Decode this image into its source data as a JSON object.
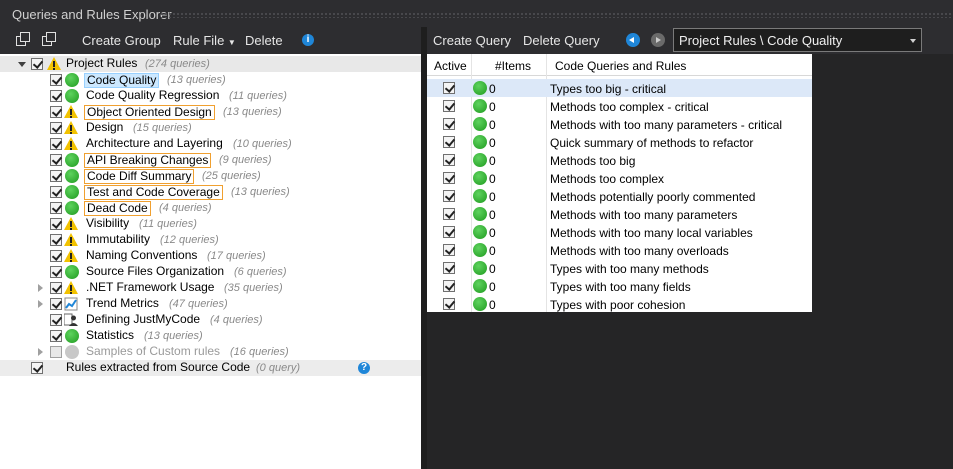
{
  "window": {
    "title": "Queries and Rules Explorer"
  },
  "left_toolbar": {
    "create_group": "Create Group",
    "rule_file": "Rule File",
    "delete": "Delete",
    "icons": [
      "collapse-all-icon",
      "expand-all-icon",
      "dropdown-arrow-icon",
      "info-icon"
    ]
  },
  "right_toolbar": {
    "create_query": "Create Query",
    "delete_query": "Delete Query",
    "breadcrumb_value": "Project Rules \\ Code Quality"
  },
  "tree": {
    "root": {
      "label": "Project Rules",
      "count": "(274 queries)",
      "checked": true,
      "status": "warning"
    },
    "groups": [
      {
        "label": "Code Quality",
        "count": "(13 queries)",
        "status": "ok",
        "checked": true,
        "expandable": false,
        "style": "selected"
      },
      {
        "label": "Code Quality Regression",
        "count": "(11 queries)",
        "status": "ok",
        "checked": true,
        "expandable": false,
        "style": ""
      },
      {
        "label": "Object Oriented Design",
        "count": "(13 queries)",
        "status": "warning",
        "checked": true,
        "expandable": false,
        "style": "boxed"
      },
      {
        "label": "Design",
        "count": "(15 queries)",
        "status": "warning",
        "checked": true,
        "expandable": false,
        "style": ""
      },
      {
        "label": "Architecture and Layering",
        "count": "(10 queries)",
        "status": "warning",
        "checked": true,
        "expandable": false,
        "style": ""
      },
      {
        "label": "API Breaking Changes",
        "count": "(9 queries)",
        "status": "ok",
        "checked": true,
        "expandable": false,
        "style": "boxed"
      },
      {
        "label": "Code Diff Summary",
        "count": "(25 queries)",
        "status": "ok",
        "checked": true,
        "expandable": false,
        "style": "boxed"
      },
      {
        "label": "Test and Code Coverage",
        "count": "(13 queries)",
        "status": "ok",
        "checked": true,
        "expandable": false,
        "style": "boxed"
      },
      {
        "label": "Dead Code",
        "count": "(4 queries)",
        "status": "ok",
        "checked": true,
        "expandable": false,
        "style": "boxed"
      },
      {
        "label": "Visibility",
        "count": "(11 queries)",
        "status": "warning",
        "checked": true,
        "expandable": false,
        "style": ""
      },
      {
        "label": "Immutability",
        "count": "(12 queries)",
        "status": "warning",
        "checked": true,
        "expandable": false,
        "style": ""
      },
      {
        "label": "Naming Conventions",
        "count": "(17 queries)",
        "status": "warning",
        "checked": true,
        "expandable": false,
        "style": ""
      },
      {
        "label": "Source Files Organization",
        "count": "(6 queries)",
        "status": "ok",
        "checked": true,
        "expandable": false,
        "style": ""
      },
      {
        "label": ".NET Framework Usage",
        "count": "(35 queries)",
        "status": "warning",
        "checked": true,
        "expandable": true,
        "style": ""
      },
      {
        "label": "Trend Metrics",
        "count": "(47 queries)",
        "status": "trend",
        "checked": true,
        "expandable": true,
        "style": ""
      },
      {
        "label": "Defining JustMyCode",
        "count": "(4 queries)",
        "status": "person",
        "checked": true,
        "expandable": false,
        "style": ""
      },
      {
        "label": "Statistics",
        "count": "(13 queries)",
        "status": "ok",
        "checked": true,
        "expandable": false,
        "style": ""
      },
      {
        "label": "Samples of Custom rules",
        "count": "(16 queries)",
        "status": "disabled",
        "checked": false,
        "expandable": true,
        "style": "dim"
      }
    ],
    "source_rules": {
      "label": "Rules extracted from Source Code",
      "count": "(0 query)",
      "checked": true
    }
  },
  "grid": {
    "headers": {
      "active": "Active",
      "items": "#Items",
      "name": "Code Queries and Rules"
    },
    "rows": [
      {
        "items": "0",
        "name": "Types too big - critical",
        "highlight": true
      },
      {
        "items": "0",
        "name": "Methods too complex - critical",
        "highlight": false
      },
      {
        "items": "0",
        "name": "Methods with too many parameters - critical",
        "highlight": false
      },
      {
        "items": "0",
        "name": "Quick summary of methods to refactor",
        "highlight": false
      },
      {
        "items": "0",
        "name": "Methods too big",
        "highlight": false
      },
      {
        "items": "0",
        "name": "Methods too complex",
        "highlight": false
      },
      {
        "items": "0",
        "name": "Methods potentially poorly commented",
        "highlight": false
      },
      {
        "items": "0",
        "name": "Methods with too many parameters",
        "highlight": false
      },
      {
        "items": "0",
        "name": "Methods with too many local variables",
        "highlight": false
      },
      {
        "items": "0",
        "name": "Methods with too many overloads",
        "highlight": false
      },
      {
        "items": "0",
        "name": "Types with too many methods",
        "highlight": false
      },
      {
        "items": "0",
        "name": "Types with too many fields",
        "highlight": false
      },
      {
        "items": "0",
        "name": "Types with poor cohesion",
        "highlight": false
      }
    ]
  },
  "colors": {
    "accent_blue": "#1f86d8",
    "ok_green": "#2fb52f",
    "warning_yellow": "#f2c200",
    "highlight_orange": "#f0a030"
  }
}
